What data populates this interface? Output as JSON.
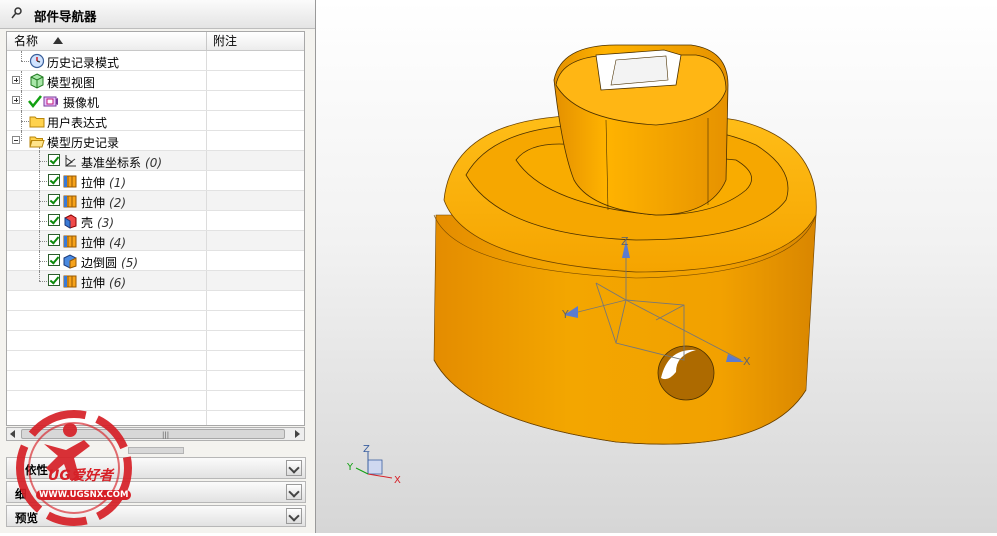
{
  "navigator": {
    "title": "部件导航器",
    "columns": {
      "name": "名称",
      "note": "附注"
    },
    "top_items": [
      {
        "label": "历史记录模式",
        "icon": "clock-icon"
      },
      {
        "label": "模型视图",
        "icon": "model-view-icon",
        "expanded": false
      },
      {
        "label": "摄像机",
        "icon": "camera-icon",
        "expanded": false,
        "checked": true
      },
      {
        "label": "用户表达式",
        "icon": "folder-icon"
      },
      {
        "label": "模型历史记录",
        "icon": "open-folder-icon",
        "expanded": true
      }
    ],
    "history": [
      {
        "label": "基准坐标系",
        "num": "(0)",
        "icon": "datum-csys-icon",
        "checked": true
      },
      {
        "label": "拉伸",
        "num": "(1)",
        "icon": "extrude-icon",
        "checked": true
      },
      {
        "label": "拉伸",
        "num": "(2)",
        "icon": "extrude-icon",
        "checked": true
      },
      {
        "label": "壳",
        "num": "(3)",
        "icon": "shell-icon",
        "checked": true
      },
      {
        "label": "拉伸",
        "num": "(4)",
        "icon": "extrude-icon",
        "checked": true
      },
      {
        "label": "边倒圆",
        "num": "(5)",
        "icon": "edge-blend-icon",
        "checked": true
      },
      {
        "label": "拉伸",
        "num": "(6)",
        "icon": "extrude-icon",
        "checked": true
      }
    ],
    "sections": [
      {
        "label": "依性"
      },
      {
        "label": "细"
      },
      {
        "label": "预览"
      }
    ]
  },
  "watermark": {
    "brand": "UG爱好者",
    "url": "WWW.UGSNX.COM"
  },
  "viewport": {
    "csys_labels": {
      "x": "X",
      "y": "Y",
      "z": "Z"
    },
    "triad_labels": {
      "x": "X",
      "y": "Y",
      "z": "Z"
    }
  },
  "colors": {
    "part": "#f0a000",
    "part_dark": "#c67a00",
    "part_light": "#ffc83c",
    "watermark": "#d62027"
  }
}
